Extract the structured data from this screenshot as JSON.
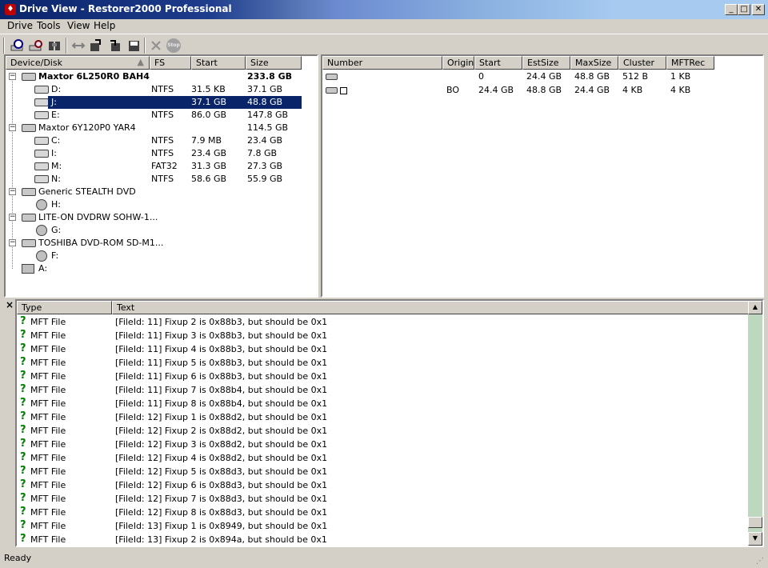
{
  "window": {
    "title": "Drive View - Restorer2000 Professional",
    "controls": [
      "_",
      "□",
      "✕"
    ]
  },
  "menu": [
    "Drive",
    "Tools",
    "View",
    "Help"
  ],
  "toolbar": {
    "icons": [
      "scan-drive-icon",
      "search-drive-icon",
      "find-icon",
      "connect-icon",
      "open-volume-icon",
      "open-file-icon",
      "save-icon",
      "delete-icon",
      "stop-icon"
    ],
    "stop_label": "Stop"
  },
  "device_panel": {
    "columns": [
      "Device/Disk",
      "FS",
      "Start",
      "Size"
    ],
    "rows": [
      {
        "type": "disk",
        "name": "Maxtor 6L250R0 BAH4",
        "fs": "",
        "start": "",
        "size": "233.8 GB",
        "bold": true
      },
      {
        "type": "vol",
        "name": "D:",
        "fs": "NTFS",
        "start": "31.5 KB",
        "size": "37.1 GB"
      },
      {
        "type": "vol",
        "name": "J:",
        "fs": "",
        "start": "37.1 GB",
        "size": "48.8 GB",
        "selected": true
      },
      {
        "type": "vol",
        "name": "E:",
        "fs": "NTFS",
        "start": "86.0 GB",
        "size": "147.8 GB"
      },
      {
        "type": "disk",
        "name": "Maxtor 6Y120P0 YAR4",
        "fs": "",
        "start": "",
        "size": "114.5 GB"
      },
      {
        "type": "vol",
        "name": "C:",
        "fs": "NTFS",
        "start": "7.9 MB",
        "size": "23.4 GB"
      },
      {
        "type": "vol",
        "name": "I:",
        "fs": "NTFS",
        "start": "23.4 GB",
        "size": "7.8 GB"
      },
      {
        "type": "vol",
        "name": "M:",
        "fs": "FAT32",
        "start": "31.3 GB",
        "size": "27.3 GB"
      },
      {
        "type": "vol",
        "name": "N:",
        "fs": "NTFS",
        "start": "58.6 GB",
        "size": "55.9 GB"
      },
      {
        "type": "disk",
        "name": "Generic STEALTH DVD",
        "fs": "",
        "start": "",
        "size": ""
      },
      {
        "type": "cd",
        "name": "H:",
        "fs": "",
        "start": "",
        "size": ""
      },
      {
        "type": "disk",
        "name": "LITE-ON DVDRW SOHW-1...",
        "fs": "",
        "start": "",
        "size": ""
      },
      {
        "type": "cd",
        "name": "G:",
        "fs": "",
        "start": "",
        "size": ""
      },
      {
        "type": "disk",
        "name": "TOSHIBA DVD-ROM SD-M1...",
        "fs": "",
        "start": "",
        "size": ""
      },
      {
        "type": "cd",
        "name": "F:",
        "fs": "",
        "start": "",
        "size": ""
      },
      {
        "type": "floppy",
        "name": "A:",
        "fs": "",
        "start": "",
        "size": ""
      }
    ]
  },
  "partition_panel": {
    "columns": [
      "Number",
      "Origin",
      "Start",
      "EstSize",
      "MaxSize",
      "Cluster",
      "MFTRec"
    ],
    "rows": [
      {
        "number": "",
        "origin": "",
        "start": "0",
        "estsize": "24.4 GB",
        "maxsize": "48.8 GB",
        "cluster": "512 B",
        "mftrec": "1 KB",
        "checkbox": false
      },
      {
        "number": "",
        "origin": "BO",
        "start": "24.4 GB",
        "estsize": "48.8 GB",
        "maxsize": "24.4 GB",
        "cluster": "4 KB",
        "mftrec": "4 KB",
        "checkbox": true
      }
    ]
  },
  "log_panel": {
    "close_label": "×",
    "columns": [
      "Type",
      "Text"
    ],
    "rows": [
      {
        "type": "MFT File",
        "text": "[FileId: 11] Fixup 2 is 0x88b3, but should be 0x1"
      },
      {
        "type": "MFT File",
        "text": "[FileId: 11] Fixup 3 is 0x88b3, but should be 0x1"
      },
      {
        "type": "MFT File",
        "text": "[FileId: 11] Fixup 4 is 0x88b3, but should be 0x1"
      },
      {
        "type": "MFT File",
        "text": "[FileId: 11] Fixup 5 is 0x88b3, but should be 0x1"
      },
      {
        "type": "MFT File",
        "text": "[FileId: 11] Fixup 6 is 0x88b3, but should be 0x1"
      },
      {
        "type": "MFT File",
        "text": "[FileId: 11] Fixup 7 is 0x88b4, but should be 0x1"
      },
      {
        "type": "MFT File",
        "text": "[FileId: 11] Fixup 8 is 0x88b4, but should be 0x1"
      },
      {
        "type": "MFT File",
        "text": "[FileId: 12] Fixup 1 is 0x88d2, but should be 0x1"
      },
      {
        "type": "MFT File",
        "text": "[FileId: 12] Fixup 2 is 0x88d2, but should be 0x1"
      },
      {
        "type": "MFT File",
        "text": "[FileId: 12] Fixup 3 is 0x88d2, but should be 0x1"
      },
      {
        "type": "MFT File",
        "text": "[FileId: 12] Fixup 4 is 0x88d2, but should be 0x1"
      },
      {
        "type": "MFT File",
        "text": "[FileId: 12] Fixup 5 is 0x88d3, but should be 0x1"
      },
      {
        "type": "MFT File",
        "text": "[FileId: 12] Fixup 6 is 0x88d3, but should be 0x1"
      },
      {
        "type": "MFT File",
        "text": "[FileId: 12] Fixup 7 is 0x88d3, but should be 0x1"
      },
      {
        "type": "MFT File",
        "text": "[FileId: 12] Fixup 8 is 0x88d3, but should be 0x1"
      },
      {
        "type": "MFT File",
        "text": "[FileId: 13] Fixup 1 is 0x8949, but should be 0x1"
      },
      {
        "type": "MFT File",
        "text": "[FileId: 13] Fixup 2 is 0x894a, but should be 0x1"
      }
    ],
    "scroll_up": "▲",
    "scroll_down": "▼"
  },
  "status": {
    "text": "Ready"
  },
  "colors": {
    "selection": "#0a246a",
    "scroll_track": "#bed8c0",
    "question": "#008000"
  }
}
